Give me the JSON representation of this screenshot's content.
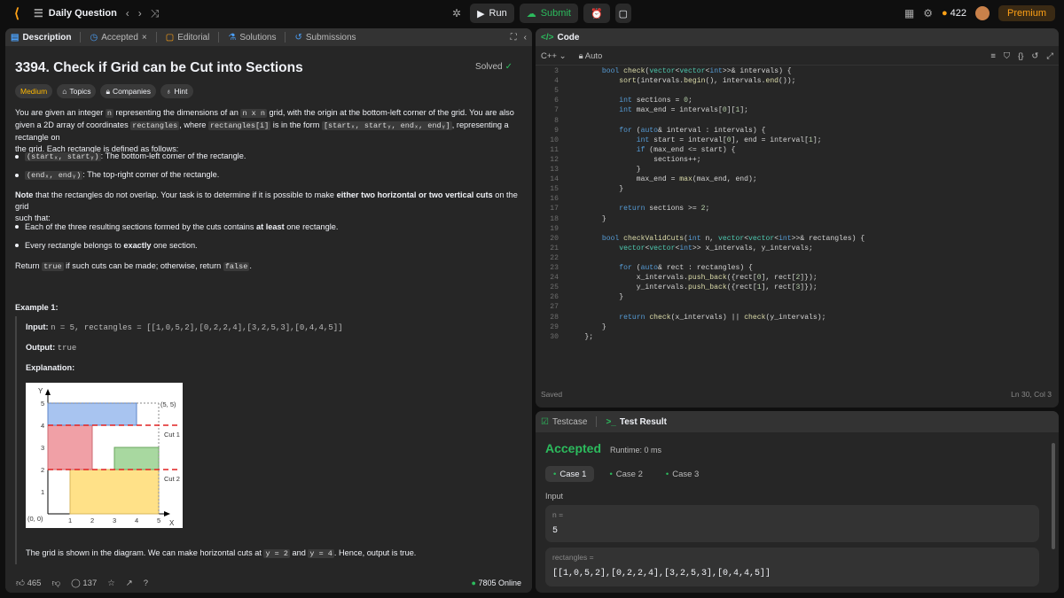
{
  "topbar": {
    "title": "Daily Question",
    "run": "Run",
    "submit": "Submit",
    "streak": "422",
    "premium": "Premium"
  },
  "desc_tabs": [
    "Description",
    "Accepted",
    "Editorial",
    "Solutions",
    "Submissions"
  ],
  "problem": {
    "title": "3394. Check if Grid can be Cut into Sections",
    "status": "Solved",
    "tags": [
      "Medium",
      "Topics",
      "Companies",
      "Hint"
    ],
    "p1a": "You are given an integer ",
    "p1_n": "n",
    "p1b": " representing the dimensions of an ",
    "p1_nxn": "n x n",
    "p1c": " grid, with the origin at the bottom-left corner of the grid. You are also",
    "p2a": "given a 2D array of coordinates ",
    "p2_rect": "rectangles",
    "p2b": ", where ",
    "p2_recti": "rectangles[i]",
    "p2c": " is in the form ",
    "p2_form": "[startₓ, startᵧ, endₓ, endᵧ]",
    "p2d": ", representing a rectangle on",
    "p3": "the grid. Each rectangle is defined as follows:",
    "b1_code": "(startₓ, startᵧ)",
    "b1_text": ": The bottom-left corner of the rectangle.",
    "b2_code": "(endₓ, endᵧ)",
    "b2_text": ": The top-right corner of the rectangle.",
    "note_b": "Note",
    "note_a": " that the rectangles do not overlap. Your task is to determine if it is possible to make ",
    "note_bold": "either two horizontal or two vertical cuts",
    "note_c": " on the grid",
    "note_d": "such that:",
    "c1a": "Each of the three resulting sections formed by the cuts contains ",
    "c1b": "at least",
    "c1c": " one rectangle.",
    "c2a": "Every rectangle belongs to ",
    "c2b": "exactly",
    "c2c": " one section.",
    "ret_a": "Return ",
    "ret_true": "true",
    "ret_b": " if such cuts can be made; otherwise, return ",
    "ret_false": "false",
    "ret_c": "."
  },
  "example": {
    "heading": "Example 1:",
    "input_label": "Input:",
    "input_value": "n = 5, rectangles = [[1,0,5,2],[0,2,2,4],[3,2,5,3],[0,4,4,5]]",
    "output_label": "Output:",
    "output_value": "true",
    "explanation_label": "Explanation:",
    "exp_a": "The grid is shown in the diagram. We can make horizontal cuts at ",
    "exp_y2": "y = 2",
    "exp_and": " and ",
    "exp_y4": "y = 4",
    "exp_b": ". Hence, output is true."
  },
  "diagram": {
    "y_axis": "Y",
    "x_axis": "X",
    "origin": "(0, 0)",
    "corner": "(5, 5)",
    "cut1": "Cut 1",
    "cut2": "Cut 2",
    "x_ticks": [
      "1",
      "2",
      "3",
      "4",
      "5"
    ],
    "y_ticks": [
      "1",
      "2",
      "3",
      "4",
      "5"
    ]
  },
  "footer": {
    "likes": "465",
    "comments": "137",
    "online": "7805 Online"
  },
  "code_panel": {
    "title": "Code",
    "lang": "C++",
    "auto": "Auto",
    "saved": "Saved",
    "cursor": "Ln 30, Col 3",
    "lines": [
      {
        "n": "3",
        "t": "        bool check(vector<vector<int>>& intervals) {"
      },
      {
        "n": "4",
        "t": "            sort(intervals.begin(), intervals.end());"
      },
      {
        "n": "5",
        "t": ""
      },
      {
        "n": "6",
        "t": "            int sections = 0;"
      },
      {
        "n": "7",
        "t": "            int max_end = intervals[0][1];"
      },
      {
        "n": "8",
        "t": ""
      },
      {
        "n": "9",
        "t": "            for (auto& interval : intervals) {"
      },
      {
        "n": "10",
        "t": "                int start = interval[0], end = interval[1];"
      },
      {
        "n": "11",
        "t": "                if (max_end <= start) {"
      },
      {
        "n": "12",
        "t": "                    sections++;"
      },
      {
        "n": "13",
        "t": "                }"
      },
      {
        "n": "14",
        "t": "                max_end = max(max_end, end);"
      },
      {
        "n": "15",
        "t": "            }"
      },
      {
        "n": "16",
        "t": ""
      },
      {
        "n": "17",
        "t": "            return sections >= 2;"
      },
      {
        "n": "18",
        "t": "        }"
      },
      {
        "n": "19",
        "t": ""
      },
      {
        "n": "20",
        "t": "        bool checkValidCuts(int n, vector<vector<int>>& rectangles) {"
      },
      {
        "n": "21",
        "t": "            vector<vector<int>> x_intervals, y_intervals;"
      },
      {
        "n": "22",
        "t": ""
      },
      {
        "n": "23",
        "t": "            for (auto& rect : rectangles) {"
      },
      {
        "n": "24",
        "t": "                x_intervals.push_back({rect[0], rect[2]});"
      },
      {
        "n": "25",
        "t": "                y_intervals.push_back({rect[1], rect[3]});"
      },
      {
        "n": "26",
        "t": "            }"
      },
      {
        "n": "27",
        "t": ""
      },
      {
        "n": "28",
        "t": "            return check(x_intervals) || check(y_intervals);"
      },
      {
        "n": "29",
        "t": "        }"
      },
      {
        "n": "30",
        "t": "    };"
      }
    ]
  },
  "test_panel": {
    "tab1": "Testcase",
    "tab2": "Test Result",
    "verdict": "Accepted",
    "runtime": "Runtime: 0 ms",
    "cases": [
      "Case 1",
      "Case 2",
      "Case 3"
    ],
    "input_label": "Input",
    "n_label": "n =",
    "n_value": "5",
    "rect_label": "rectangles =",
    "rect_value": "[[1,0,5,2],[0,2,2,4],[3,2,5,3],[0,4,4,5]]"
  },
  "colors": {
    "accent_green": "#2cbb5d",
    "medium": "#ffb800",
    "premium": "#ffa116"
  }
}
